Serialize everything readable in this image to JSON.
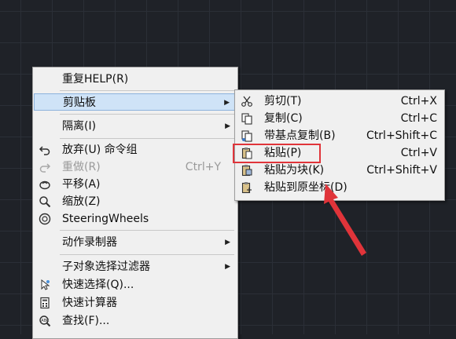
{
  "main_menu": {
    "items": [
      {
        "label": "重复HELP(R)"
      },
      {
        "label": "剪贴板"
      },
      {
        "label": "隔离(I)"
      },
      {
        "label": "放弃(U) 命令组"
      },
      {
        "label": "重做(R)",
        "shortcut": "Ctrl+Y"
      },
      {
        "label": "平移(A)"
      },
      {
        "label": "缩放(Z)"
      },
      {
        "label": "SteeringWheels"
      },
      {
        "label": "动作录制器"
      },
      {
        "label": "子对象选择过滤器"
      },
      {
        "label": "快速选择(Q)..."
      },
      {
        "label": "快速计算器"
      },
      {
        "label": "查找(F)..."
      }
    ]
  },
  "submenu": {
    "items": [
      {
        "label": "剪切(T)",
        "shortcut": "Ctrl+X"
      },
      {
        "label": "复制(C)",
        "shortcut": "Ctrl+C"
      },
      {
        "label": "带基点复制(B)",
        "shortcut": "Ctrl+Shift+C"
      },
      {
        "label": "粘贴(P)",
        "shortcut": "Ctrl+V"
      },
      {
        "label": "粘贴为块(K)",
        "shortcut": "Ctrl+Shift+V"
      },
      {
        "label": "粘贴到原坐标(D)"
      }
    ]
  },
  "colors": {
    "highlight": "#cfe3f7",
    "callout": "#e0343a",
    "background": "#1f2228"
  }
}
